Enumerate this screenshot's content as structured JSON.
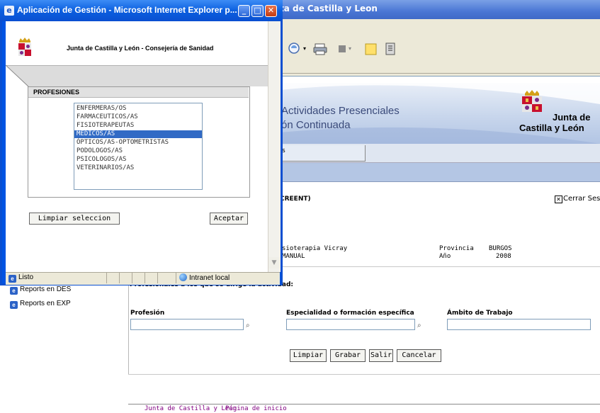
{
  "background_window": {
    "title": "ta de Castilla y Leon",
    "banner": {
      "line1": "Actividades Presenciales",
      "line2": "ón Continuada",
      "logo_line1": "Junta de",
      "logo_line2": "Castilla y León"
    },
    "tab_label": "s",
    "section_label": "CREENT)",
    "close_session": "Cerrar Sesio",
    "info": {
      "row1": "sioterapia Vicray",
      "row2": "MANUAL",
      "provincia_label": "Provincia",
      "provincia_value": "BURGOS",
      "ano_label": "Año",
      "ano_value": "2008"
    },
    "sidebar": {
      "items": [
        {
          "label": "Reports en DES"
        },
        {
          "label": "Reports en EXP"
        }
      ]
    },
    "form": {
      "heading": "Profesionales a los que se dirige la actividad:",
      "fields": {
        "profesion_label": "Profesión",
        "especialidad_label": "Especialidad o formación específica",
        "ambito_label": "Ámbito de Trabajo"
      },
      "buttons": {
        "limpiar": "Limpiar",
        "grabar": "Grabar",
        "salir": "Salir",
        "cancelar": "Cancelar"
      }
    },
    "footer": {
      "jcyl_link": "Junta de Castilla y León",
      "home_link": "Página de inicio"
    }
  },
  "popup": {
    "title": "Aplicación de Gestión - Microsoft Internet Explorer p...",
    "header_text": "Junta de Castilla y León - Consejería de Sanidad",
    "panel_title": "PROFESIONES",
    "options": [
      {
        "label": "ENFERMERAS/OS",
        "selected": false
      },
      {
        "label": "FARMACEUTICOS/AS",
        "selected": false
      },
      {
        "label": "FISIOTERAPEUTAS",
        "selected": false
      },
      {
        "label": "MÉDICOS/AS",
        "selected": true
      },
      {
        "label": "ÓPTICOS/AS-OPTOMETRISTAS",
        "selected": false
      },
      {
        "label": "PODOLOGOS/AS",
        "selected": false
      },
      {
        "label": "PSICOLOGOS/AS",
        "selected": false
      },
      {
        "label": "VETERINARIOS/AS",
        "selected": false
      }
    ],
    "buttons": {
      "clear": "Limpiar seleccion",
      "accept": "Aceptar"
    },
    "status": {
      "left": "Listo",
      "zone": "Intranet local"
    }
  },
  "colors": {
    "selection": "#316ac5",
    "titlebar": "#0a4fd1",
    "link": "#800080"
  }
}
